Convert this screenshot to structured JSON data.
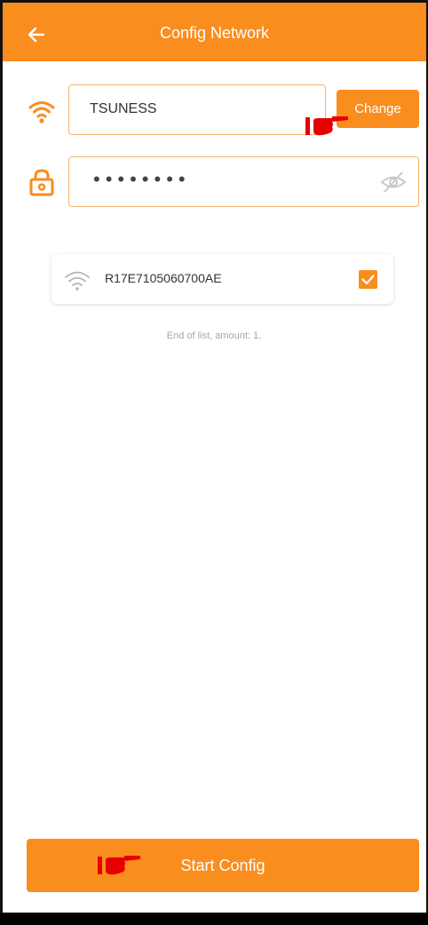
{
  "header": {
    "title": "Config Network",
    "back_icon": "arrow-left-icon"
  },
  "network": {
    "ssid": "TSUNESS",
    "change_label": "Change",
    "password_mask": "••••••••",
    "wifi_icon": "wifi-icon",
    "lock_icon": "lock-icon",
    "visibility_icon": "eye-off-icon"
  },
  "devices": {
    "items": [
      {
        "name": "R17E7105060700AE",
        "checked": true
      }
    ],
    "end_text": "End of list, amount: 1."
  },
  "footer": {
    "start_label": "Start Config"
  },
  "colors": {
    "accent": "#f98d1e",
    "field_border": "#f2b56a",
    "pointer": "#e60000"
  }
}
